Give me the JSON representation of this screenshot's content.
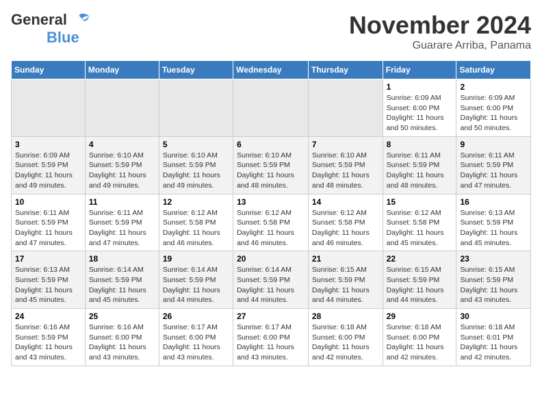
{
  "header": {
    "logo_line1": "General",
    "logo_line2": "Blue",
    "month": "November 2024",
    "location": "Guarare Arriba, Panama"
  },
  "days_of_week": [
    "Sunday",
    "Monday",
    "Tuesday",
    "Wednesday",
    "Thursday",
    "Friday",
    "Saturday"
  ],
  "weeks": [
    {
      "days": [
        {
          "num": "",
          "info": ""
        },
        {
          "num": "",
          "info": ""
        },
        {
          "num": "",
          "info": ""
        },
        {
          "num": "",
          "info": ""
        },
        {
          "num": "",
          "info": ""
        },
        {
          "num": "1",
          "info": "Sunrise: 6:09 AM\nSunset: 6:00 PM\nDaylight: 11 hours\nand 50 minutes."
        },
        {
          "num": "2",
          "info": "Sunrise: 6:09 AM\nSunset: 6:00 PM\nDaylight: 11 hours\nand 50 minutes."
        }
      ]
    },
    {
      "days": [
        {
          "num": "3",
          "info": "Sunrise: 6:09 AM\nSunset: 5:59 PM\nDaylight: 11 hours\nand 49 minutes."
        },
        {
          "num": "4",
          "info": "Sunrise: 6:10 AM\nSunset: 5:59 PM\nDaylight: 11 hours\nand 49 minutes."
        },
        {
          "num": "5",
          "info": "Sunrise: 6:10 AM\nSunset: 5:59 PM\nDaylight: 11 hours\nand 49 minutes."
        },
        {
          "num": "6",
          "info": "Sunrise: 6:10 AM\nSunset: 5:59 PM\nDaylight: 11 hours\nand 48 minutes."
        },
        {
          "num": "7",
          "info": "Sunrise: 6:10 AM\nSunset: 5:59 PM\nDaylight: 11 hours\nand 48 minutes."
        },
        {
          "num": "8",
          "info": "Sunrise: 6:11 AM\nSunset: 5:59 PM\nDaylight: 11 hours\nand 48 minutes."
        },
        {
          "num": "9",
          "info": "Sunrise: 6:11 AM\nSunset: 5:59 PM\nDaylight: 11 hours\nand 47 minutes."
        }
      ]
    },
    {
      "days": [
        {
          "num": "10",
          "info": "Sunrise: 6:11 AM\nSunset: 5:59 PM\nDaylight: 11 hours\nand 47 minutes."
        },
        {
          "num": "11",
          "info": "Sunrise: 6:11 AM\nSunset: 5:59 PM\nDaylight: 11 hours\nand 47 minutes."
        },
        {
          "num": "12",
          "info": "Sunrise: 6:12 AM\nSunset: 5:58 PM\nDaylight: 11 hours\nand 46 minutes."
        },
        {
          "num": "13",
          "info": "Sunrise: 6:12 AM\nSunset: 5:58 PM\nDaylight: 11 hours\nand 46 minutes."
        },
        {
          "num": "14",
          "info": "Sunrise: 6:12 AM\nSunset: 5:58 PM\nDaylight: 11 hours\nand 46 minutes."
        },
        {
          "num": "15",
          "info": "Sunrise: 6:12 AM\nSunset: 5:58 PM\nDaylight: 11 hours\nand 45 minutes."
        },
        {
          "num": "16",
          "info": "Sunrise: 6:13 AM\nSunset: 5:59 PM\nDaylight: 11 hours\nand 45 minutes."
        }
      ]
    },
    {
      "days": [
        {
          "num": "17",
          "info": "Sunrise: 6:13 AM\nSunset: 5:59 PM\nDaylight: 11 hours\nand 45 minutes."
        },
        {
          "num": "18",
          "info": "Sunrise: 6:14 AM\nSunset: 5:59 PM\nDaylight: 11 hours\nand 45 minutes."
        },
        {
          "num": "19",
          "info": "Sunrise: 6:14 AM\nSunset: 5:59 PM\nDaylight: 11 hours\nand 44 minutes."
        },
        {
          "num": "20",
          "info": "Sunrise: 6:14 AM\nSunset: 5:59 PM\nDaylight: 11 hours\nand 44 minutes."
        },
        {
          "num": "21",
          "info": "Sunrise: 6:15 AM\nSunset: 5:59 PM\nDaylight: 11 hours\nand 44 minutes."
        },
        {
          "num": "22",
          "info": "Sunrise: 6:15 AM\nSunset: 5:59 PM\nDaylight: 11 hours\nand 44 minutes."
        },
        {
          "num": "23",
          "info": "Sunrise: 6:15 AM\nSunset: 5:59 PM\nDaylight: 11 hours\nand 43 minutes."
        }
      ]
    },
    {
      "days": [
        {
          "num": "24",
          "info": "Sunrise: 6:16 AM\nSunset: 5:59 PM\nDaylight: 11 hours\nand 43 minutes."
        },
        {
          "num": "25",
          "info": "Sunrise: 6:16 AM\nSunset: 6:00 PM\nDaylight: 11 hours\nand 43 minutes."
        },
        {
          "num": "26",
          "info": "Sunrise: 6:17 AM\nSunset: 6:00 PM\nDaylight: 11 hours\nand 43 minutes."
        },
        {
          "num": "27",
          "info": "Sunrise: 6:17 AM\nSunset: 6:00 PM\nDaylight: 11 hours\nand 43 minutes."
        },
        {
          "num": "28",
          "info": "Sunrise: 6:18 AM\nSunset: 6:00 PM\nDaylight: 11 hours\nand 42 minutes."
        },
        {
          "num": "29",
          "info": "Sunrise: 6:18 AM\nSunset: 6:00 PM\nDaylight: 11 hours\nand 42 minutes."
        },
        {
          "num": "30",
          "info": "Sunrise: 6:18 AM\nSunset: 6:01 PM\nDaylight: 11 hours\nand 42 minutes."
        }
      ]
    }
  ]
}
